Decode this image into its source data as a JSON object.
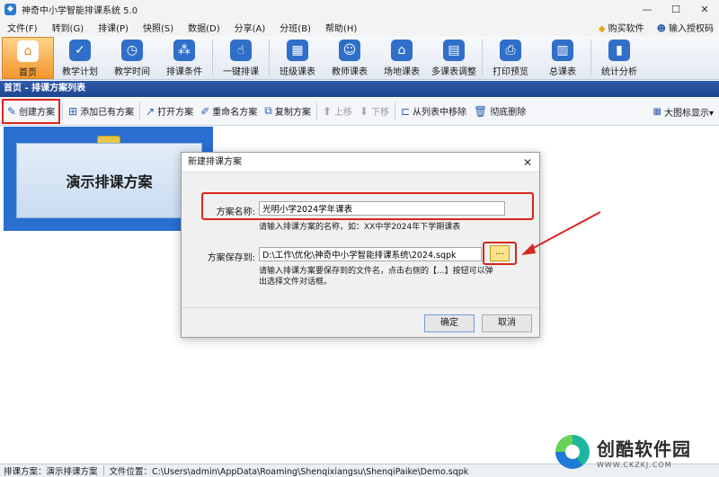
{
  "window": {
    "title": "神奇中小学智能排课系统 5.0",
    "icon_name": "app-logo-icon",
    "controls": [
      "—",
      "☐",
      "✕"
    ]
  },
  "menu": {
    "items": [
      "文件(F)",
      "转到(G)",
      "排课(P)",
      "快照(S)",
      "数据(D)",
      "分享(A)",
      "分班(B)",
      "帮助(H)"
    ],
    "buy": "购买软件",
    "license": "输入授权码"
  },
  "ribbon": {
    "items": [
      {
        "label": "首页",
        "icon": "home-icon",
        "glyph": "⌂"
      },
      {
        "label": "教学计划",
        "icon": "clipboard-check-icon",
        "glyph": "✓"
      },
      {
        "label": "教学时间",
        "icon": "clock-icon",
        "glyph": "◷"
      },
      {
        "label": "排课条件",
        "icon": "conditions-icon",
        "glyph": "⁂"
      },
      {
        "label": "一键排课",
        "icon": "one-click-icon",
        "glyph": "☝"
      },
      {
        "label": "班级课表",
        "icon": "class-table-icon",
        "glyph": "▦"
      },
      {
        "label": "教师课表",
        "icon": "teacher-table-icon",
        "glyph": "☺"
      },
      {
        "label": "场地课表",
        "icon": "venue-table-icon",
        "glyph": "⌂"
      },
      {
        "label": "多课表调整",
        "icon": "multi-table-adjust-icon",
        "glyph": "▤"
      },
      {
        "label": "打印预览",
        "icon": "printer-icon",
        "glyph": "⎙"
      },
      {
        "label": "总课表",
        "icon": "master-table-icon",
        "glyph": "▥"
      },
      {
        "label": "统计分析",
        "icon": "stats-icon",
        "glyph": "▮"
      }
    ]
  },
  "panel": {
    "header": "首页 - 排课方案列表"
  },
  "toolbar": {
    "create": "创建方案",
    "add_existing": "添加已有方案",
    "open": "打开方案",
    "rename": "重命名方案",
    "copy": "复制方案",
    "move_up": "上移",
    "move_down": "下移",
    "remove_from_list": "从列表中移除",
    "delete": "彻底删除",
    "view_mode": "大图标显示▾"
  },
  "plans": [
    {
      "name": "演示排课方案"
    }
  ],
  "dialog": {
    "title": "新建排课方案",
    "close": "✕",
    "name_label": "方案名称:",
    "name_value": "光明小学2024学年课表",
    "name_hint": "请输入排课方案的名称，如：XX中学2024年下学期课表",
    "path_label": "方案保存到:",
    "path_value": "D:\\工作\\优化\\神奇中小学智能排课系统\\2024.sqpk",
    "browse": "...",
    "path_hint_line1": "请输入排课方案要保存到的文件名，点击右侧的【...】按钮可以弹",
    "path_hint_line2": "出选择文件对话框。",
    "ok": "确定",
    "cancel": "取消"
  },
  "status": {
    "plan": "排课方案：演示排课方案",
    "location": "文件位置：C:\\Users\\admin\\AppData\\Roaming\\Shenqixiangsu\\ShenqiPaike\\Demo.sqpk"
  },
  "watermark": {
    "name": "创酷软件园",
    "url": "WWW.CKZKJ.COM"
  },
  "colors": {
    "accent": "#f2962c",
    "panel_header": "#1e4590",
    "highlight_red": "#d8261f"
  }
}
